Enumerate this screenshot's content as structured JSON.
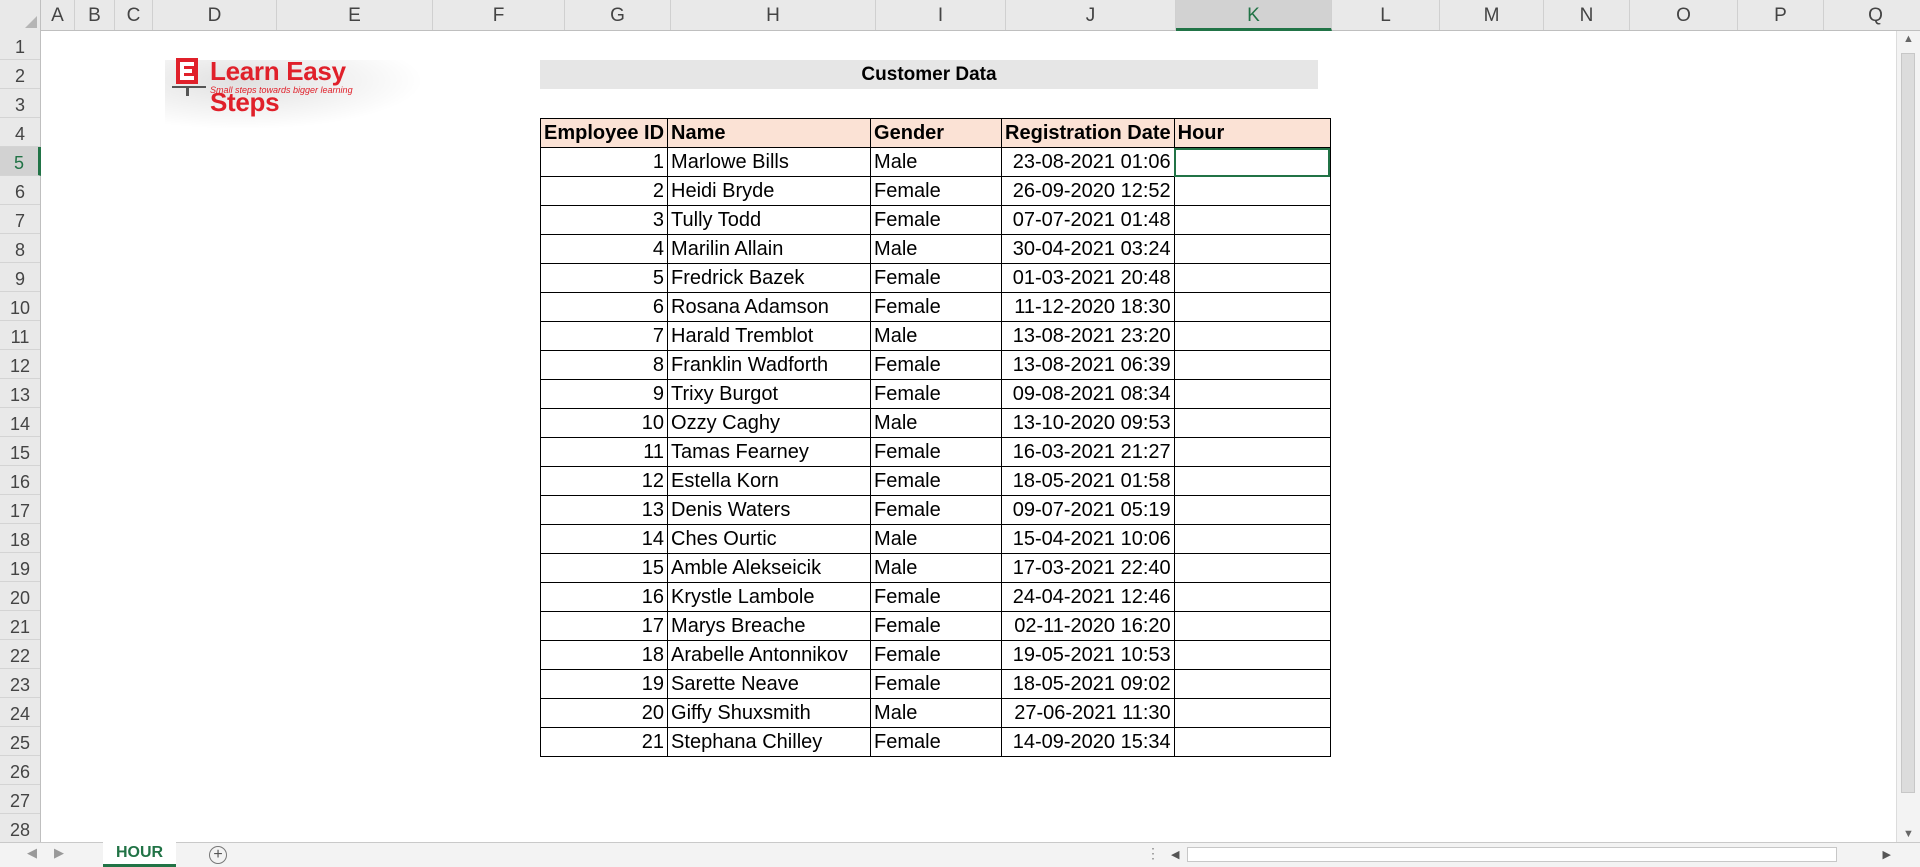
{
  "sheet": {
    "columns": [
      "A",
      "B",
      "C",
      "D",
      "E",
      "F",
      "G",
      "H",
      "I",
      "J",
      "K",
      "L",
      "M",
      "N",
      "O",
      "P",
      "Q"
    ],
    "selected_column": "K",
    "rows": [
      "1",
      "2",
      "3",
      "4",
      "5",
      "6",
      "7",
      "8",
      "9",
      "10",
      "11",
      "12",
      "13",
      "14",
      "15",
      "16",
      "17",
      "18",
      "19",
      "20",
      "21",
      "22",
      "23",
      "24",
      "25",
      "26",
      "27",
      "28"
    ],
    "selected_row": "5"
  },
  "logo": {
    "name": "Learn Easy Steps",
    "tagline": "Small steps towards bigger learning"
  },
  "title": "Customer Data",
  "table": {
    "headers": [
      "Employee ID",
      "Name",
      "Gender",
      "Registration Date",
      "Hour"
    ],
    "rows": [
      {
        "id": "1",
        "name": "Marlowe Bills",
        "gender": "Male",
        "date": "23-08-2021 01:06",
        "hour": ""
      },
      {
        "id": "2",
        "name": "Heidi Bryde",
        "gender": "Female",
        "date": "26-09-2020 12:52",
        "hour": ""
      },
      {
        "id": "3",
        "name": "Tully Todd",
        "gender": "Female",
        "date": "07-07-2021 01:48",
        "hour": ""
      },
      {
        "id": "4",
        "name": "Marilin Allain",
        "gender": "Male",
        "date": "30-04-2021 03:24",
        "hour": ""
      },
      {
        "id": "5",
        "name": "Fredrick Bazek",
        "gender": "Female",
        "date": "01-03-2021 20:48",
        "hour": ""
      },
      {
        "id": "6",
        "name": "Rosana Adamson",
        "gender": "Female",
        "date": "11-12-2020 18:30",
        "hour": ""
      },
      {
        "id": "7",
        "name": "Harald Tremblot",
        "gender": "Male",
        "date": "13-08-2021 23:20",
        "hour": ""
      },
      {
        "id": "8",
        "name": "Franklin Wadforth",
        "gender": "Female",
        "date": "13-08-2021 06:39",
        "hour": ""
      },
      {
        "id": "9",
        "name": "Trixy Burgot",
        "gender": "Female",
        "date": "09-08-2021 08:34",
        "hour": ""
      },
      {
        "id": "10",
        "name": "Ozzy Caghy",
        "gender": "Male",
        "date": "13-10-2020 09:53",
        "hour": ""
      },
      {
        "id": "11",
        "name": "Tamas Fearney",
        "gender": "Female",
        "date": "16-03-2021 21:27",
        "hour": ""
      },
      {
        "id": "12",
        "name": "Estella Korn",
        "gender": "Female",
        "date": "18-05-2021 01:58",
        "hour": ""
      },
      {
        "id": "13",
        "name": "Denis Waters",
        "gender": "Female",
        "date": "09-07-2021 05:19",
        "hour": ""
      },
      {
        "id": "14",
        "name": "Ches Ourtic",
        "gender": "Male",
        "date": "15-04-2021 10:06",
        "hour": ""
      },
      {
        "id": "15",
        "name": "Amble Alekseicik",
        "gender": "Male",
        "date": "17-03-2021 22:40",
        "hour": ""
      },
      {
        "id": "16",
        "name": "Krystle Lambole",
        "gender": "Female",
        "date": "24-04-2021 12:46",
        "hour": ""
      },
      {
        "id": "17",
        "name": "Marys Breache",
        "gender": "Female",
        "date": "02-11-2020 16:20",
        "hour": ""
      },
      {
        "id": "18",
        "name": "Arabelle Antonnikov",
        "gender": "Female",
        "date": "19-05-2021 10:53",
        "hour": ""
      },
      {
        "id": "19",
        "name": "Sarette Neave",
        "gender": "Female",
        "date": "18-05-2021 09:02",
        "hour": ""
      },
      {
        "id": "20",
        "name": "Giffy Shuxsmith",
        "gender": "Male",
        "date": "27-06-2021 11:30",
        "hour": ""
      },
      {
        "id": "21",
        "name": "Stephana Chilley",
        "gender": "Female",
        "date": "14-09-2020 15:34",
        "hour": ""
      }
    ]
  },
  "tabs": {
    "active": "HOUR",
    "add_icon": "plus-circle-icon"
  },
  "colors": {
    "accent": "#217346",
    "header_fill": "#fbe2d5",
    "title_fill": "#e6e6e6",
    "logo_red": "#e0202a"
  }
}
